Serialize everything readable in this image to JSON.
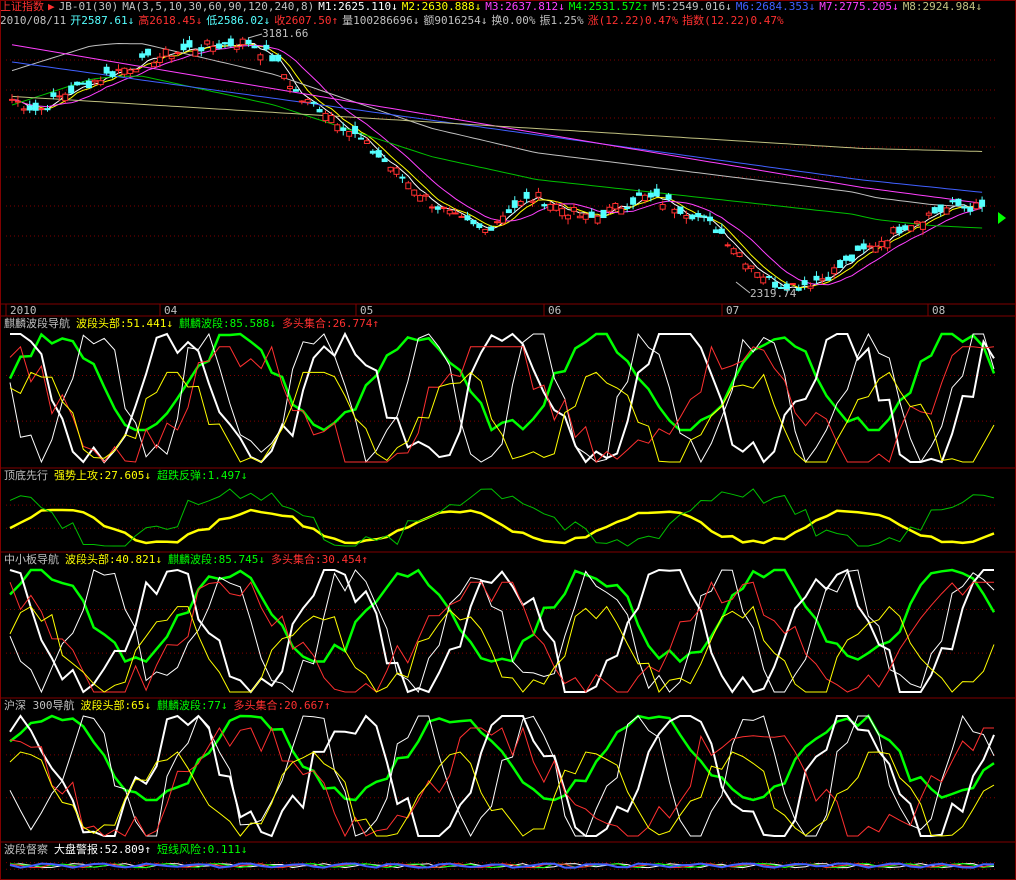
{
  "header": {
    "index_name": "上证指数",
    "formula": "JB-01(30)",
    "ma_params": "MA(3,5,10,30,60,90,120,240,8)",
    "ma_values": [
      {
        "label": "M1:2625.110↓",
        "color": "#ffffff"
      },
      {
        "label": "M2:2630.888↓",
        "color": "#ffff00"
      },
      {
        "label": "M3:2637.812↓",
        "color": "#ff40ff"
      },
      {
        "label": "M4:2531.572↑",
        "color": "#00ff00"
      },
      {
        "label": "M5:2549.016↓",
        "color": "#c0c0c0"
      },
      {
        "label": "M6:2684.353↓",
        "color": "#4060ff"
      },
      {
        "label": "M7:2775.205↓",
        "color": "#ff40ff"
      },
      {
        "label": "M8:2924.984↓",
        "color": "#c0c080"
      }
    ],
    "row2": [
      {
        "label": "2010/08/11",
        "color": "#c0c0c0"
      },
      {
        "label": "开2587.61↓",
        "color": "#54ffff"
      },
      {
        "label": "高2618.45↓",
        "color": "#ff3030"
      },
      {
        "label": "低2586.02↓",
        "color": "#54ffff"
      },
      {
        "label": "收2607.50↑",
        "color": "#ff3030"
      },
      {
        "label": "量100286696↓",
        "color": "#c0c0c0"
      },
      {
        "label": "额9016254↓",
        "color": "#c0c0c0"
      },
      {
        "label": "换0.00%",
        "color": "#c0c0c0"
      },
      {
        "label": "振1.25%",
        "color": "#c0c0c0"
      },
      {
        "label": "涨(12.22)0.47%",
        "color": "#ff3030"
      },
      {
        "label": "指数(12.22)0.47%",
        "color": "#ff3030"
      }
    ]
  },
  "price_chart": {
    "high_label": "3181.66",
    "low_label": "2319.74",
    "x_labels": [
      "2010",
      "04",
      "05",
      "06",
      "07",
      "08"
    ],
    "colors": {
      "up": "#ff3030",
      "down": "#54ffff",
      "grid": "#800000"
    }
  },
  "panels": [
    {
      "name": "麒麟波段导航",
      "items": [
        {
          "label": "波段头部:51.441↓",
          "color": "#ffff00"
        },
        {
          "label": "麒麟波段:85.588↓",
          "color": "#00ff00"
        },
        {
          "label": "多头集合:26.774↑",
          "color": "#ff3030"
        }
      ]
    },
    {
      "name": "顶底先行",
      "items": [
        {
          "label": "强势上攻:27.605↓",
          "color": "#ffff00"
        },
        {
          "label": "超跌反弹:1.497↓",
          "color": "#00ff00"
        }
      ]
    },
    {
      "name": "中小板导航",
      "items": [
        {
          "label": "波段头部:40.821↓",
          "color": "#ffff00"
        },
        {
          "label": "麒麟波段:85.745↓",
          "color": "#00ff00"
        },
        {
          "label": "多头集合:30.454↑",
          "color": "#ff3030"
        }
      ]
    },
    {
      "name": "沪深 300导航",
      "items": [
        {
          "label": "波段头部:65↓",
          "color": "#ffff00"
        },
        {
          "label": "麒麟波段:77↓",
          "color": "#00ff00"
        },
        {
          "label": "多头集合:20.667↑",
          "color": "#ff3030"
        }
      ]
    },
    {
      "name": "波段督察",
      "items": [
        {
          "label": "大盘警报:52.809↑",
          "color": "#ffffff"
        },
        {
          "label": "短线风险:0.111↓",
          "color": "#00ff00"
        }
      ]
    }
  ],
  "chart_data": {
    "type": "line",
    "y_range": [
      2319.74,
      3181.66
    ],
    "series": [
      {
        "name": "",
        "values": [
          2980,
          2940,
          3000,
          3040,
          3080,
          3110,
          3140,
          3160,
          3170,
          3181,
          3120,
          2980,
          2940,
          2860,
          2780,
          2700,
          2620,
          2560,
          2520,
          2600,
          2640,
          2600,
          2560,
          2600,
          2640,
          2620,
          2580,
          2520,
          2420,
          2340,
          2330,
          2360,
          2420,
          2480,
          2540,
          2580,
          2610,
          2600
        ]
      },
      {
        "name": "",
        "values": [
          2960,
          2990,
          3020,
          3050,
          3060,
          3060,
          3040,
          3020,
          3000,
          2980,
          2960,
          2930,
          2900,
          2870,
          2840,
          2810,
          2780,
          2760,
          2740,
          2720,
          2700,
          2690,
          2680,
          2670,
          2660,
          2650,
          2640,
          2630,
          2620,
          2610,
          2600,
          2590,
          2580,
          2560,
          2550,
          2540,
          2535,
          2531
        ]
      },
      {
        "name": "",
        "values": [
          3150,
          3140,
          3130,
          3120,
          3110,
          3100,
          3090,
          3080,
          3070,
          3060,
          3050,
          3040,
          3030,
          3020,
          3010,
          3000,
          2990,
          2980,
          2970,
          2960,
          2950,
          2940,
          2935,
          2930,
          2925
        ]
      }
    ]
  }
}
